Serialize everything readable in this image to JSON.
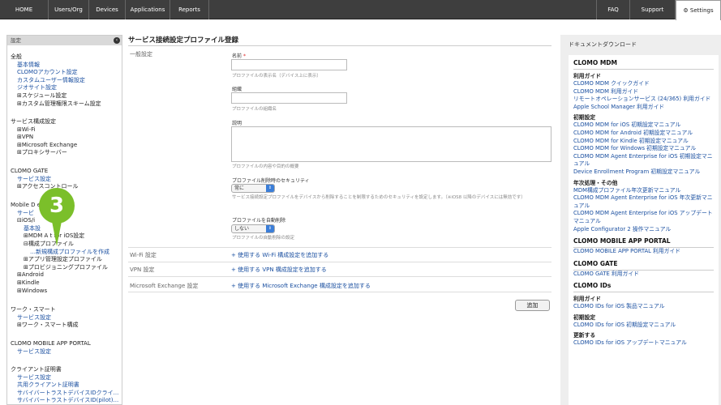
{
  "topnav": {
    "items": [
      "HOME",
      "Users/Org",
      "Devices",
      "Applications",
      "Reports"
    ],
    "right": [
      "FAQ",
      "Support"
    ],
    "settings": "Settings"
  },
  "sidebar": {
    "header": "設定",
    "g1": {
      "title": "全般",
      "items": [
        "基本情報",
        "CLOMOアカウント設定",
        "カスタムユーザー情報設定",
        "ジオサイト設定"
      ],
      "text": [
        "⊞スケジュール設定",
        "⊞カスタム管理権限スキーム設定"
      ]
    },
    "g2": {
      "title": "サービス構成設定",
      "items": [
        "⊞Wi-Fi",
        "⊞VPN",
        "⊞Microsoft Exchange",
        "⊞プロキシサーバー"
      ]
    },
    "g3": {
      "title": "CLOMO GATE",
      "link": "サービス設定",
      "text": "⊞アクセスコントロール"
    },
    "g4": {
      "title": "Mobile D       ement",
      "link": "サービ",
      "ios": "⊟iOS/i",
      "base": "基本設",
      "items": [
        "⊞MDM A     t for iOS設定",
        "⊟構成プロファイル",
        "…新規構成プロファイルを作成",
        "⊞アプリ管理設定プロファイル",
        "⊞プロビジョニングプロファイル",
        "⊞Android",
        "⊞Kindle",
        "⊞Windows"
      ]
    },
    "g5": {
      "title": "ワーク・スマート",
      "link": "サービス設定",
      "text": "⊞ワーク・スマート構成"
    },
    "g6": {
      "title": "CLOMO MOBILE APP PORTAL",
      "link": "サービス設定"
    },
    "g7": {
      "title": "クライアント証明書",
      "links": [
        "サービス設定",
        "共用クライアント証明書",
        "サバイバートラストデバイスIDクライ...",
        "サバイバートラストデバイスID(pilot)..."
      ]
    }
  },
  "badge": "3",
  "main": {
    "title": "サービス接続設定プロファイル登録",
    "general": "一般設定",
    "name_label": "名前",
    "req": "*",
    "name_help": "プロファイルの表示名（デバイス上に表示）",
    "org_label": "組織",
    "org_help": "プロファイルの組織名",
    "desc_label": "説明",
    "desc_help": "プロファイルの内容や目的の概要",
    "security_label": "プロファイル削除時のセキュリティ",
    "security_value": "常に",
    "security_help": "サービス接続設定プロファイルをデバイスから削除することを制限するためのセキュリティを設定します。（※iOS8 以降のデバイスには無効です）",
    "auto_label": "プロファイルを自動削除",
    "auto_value": "しない",
    "auto_help": "プロファイルの自動削除の設定",
    "wifi_label": "Wi-Fi 設定",
    "wifi_link": "+ 使用する Wi-Fi 構成設定を追加する",
    "vpn_label": "VPN 設定",
    "vpn_link": "+ 使用する VPN 構成設定を追加する",
    "ex_label": "Microsoft Exchange 設定",
    "ex_link": "+ 使用する Microsoft Exchange 構成設定を追加する",
    "add_button": "追加"
  },
  "docs": {
    "title": "ドキュメントダウンロード",
    "sections": [
      {
        "h": "CLOMO MDM",
        "subs": [
          {
            "s": "利用ガイド",
            "links": [
              "CLOMO MDM クイックガイド",
              "CLOMO MDM 利用ガイド",
              "リモートオペレーションサービス (24/365) 利用ガイド",
              "Apple School Manager 利用ガイド"
            ]
          },
          {
            "s": "初期設定",
            "links": [
              "CLOMO MDM for iOS 初期設定マニュアル",
              "CLOMO MDM for Android 初期設定マニュアル",
              "CLOMO MDM for Kindle 初期設定マニュアル",
              "CLOMO MDM for Windows 初期設定マニュアル",
              "CLOMO MDM Agent Enterprise for iOS 初期設定マニュアル",
              "Device Enrollment Program 初期設定マニュアル"
            ]
          },
          {
            "s": "年次処理・その他",
            "links": [
              "MDM構成プロファイル年次更新マニュアル",
              "CLOMO MDM Agent Enterprise for iOS 年次更新マニュアル",
              "CLOMO MDM Agent Enterprise for iOS アップデートマニュアル",
              "Apple Configurator 2 操作マニュアル"
            ]
          }
        ]
      },
      {
        "h": "CLOMO MOBILE APP PORTAL",
        "subs": [
          {
            "s": "",
            "links": [
              "CLOMO MOBILE APP PORTAL 利用ガイド"
            ]
          }
        ]
      },
      {
        "h": "CLOMO GATE",
        "subs": [
          {
            "s": "",
            "links": [
              "CLOMO GATE 利用ガイド"
            ]
          }
        ]
      },
      {
        "h": "CLOMO IDs",
        "subs": [
          {
            "s": "利用ガイド",
            "links": [
              "CLOMO IDs for iOS 製品マニュアル"
            ]
          },
          {
            "s": "初期設定",
            "links": [
              "CLOMO IDs for iOS 初期設定マニュアル"
            ]
          },
          {
            "s": "更新する",
            "links": [
              "CLOMO IDs for iOS アップデートマニュアル"
            ]
          }
        ]
      }
    ]
  }
}
